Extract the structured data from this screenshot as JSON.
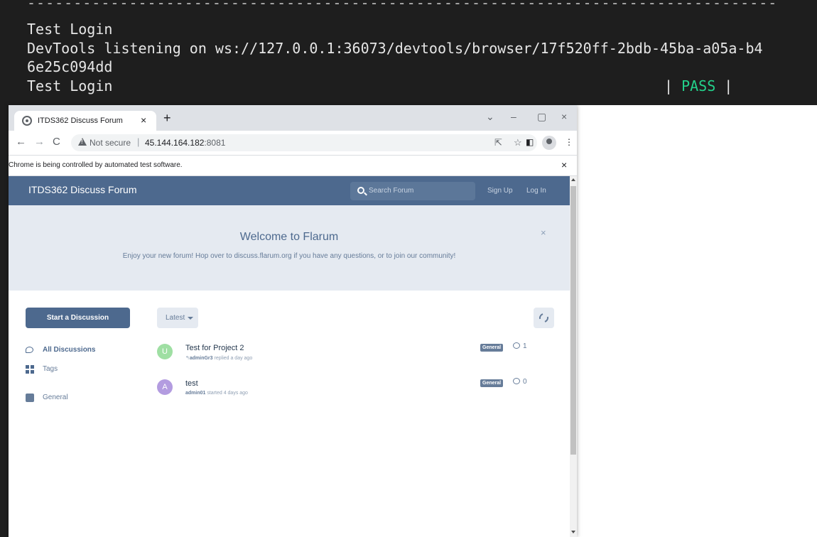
{
  "terminal": {
    "dashes": "---------------------------------------------------------------------------------",
    "line1": "Test Login",
    "line2": "DevTools listening on ws://127.0.0.1:36073/devtools/browser/17f520ff-2bdb-45ba-a05a-b4",
    "line3": "6e25c094dd",
    "line4": "Test Login",
    "pass_left": "| ",
    "pass_status": "PASS",
    "pass_right": " |",
    "status_color": "#23d18b"
  },
  "browser": {
    "tab_title": "ITDS362 Discuss Forum",
    "tab_close": "×",
    "new_tab": "+",
    "window_controls": {
      "dropdown": "⌄",
      "minimize": "–",
      "maximize": "▢",
      "close": "×"
    },
    "nav": {
      "back": "←",
      "forward": "→",
      "reload": "C"
    },
    "security_label": "Not secure",
    "url_separator": "|",
    "url_host": "45.144.164.182",
    "url_port": ":8081",
    "toolbar_icons": {
      "share": "⇱",
      "bookmark": "☆",
      "side_panel": "◧",
      "menu": "⋮"
    },
    "infobar_text": "Chrome is being controlled by automated test software.",
    "infobar_close": "×"
  },
  "forum": {
    "title": "ITDS362 Discuss Forum",
    "search_placeholder": "Search Forum",
    "signup": "Sign Up",
    "login": "Log In",
    "brand_color": "#4d698e",
    "hero": {
      "title": "Welcome to Flarum",
      "description": "Enjoy your new forum! Hop over to discuss.flarum.org if you have any questions, or to join our community!",
      "close": "×"
    },
    "start_discussion": "Start a Discussion",
    "sidebar": [
      {
        "label": "All Discussions",
        "icon": "chat-icon",
        "active": true
      },
      {
        "label": "Tags",
        "icon": "tags-icon",
        "active": false
      },
      {
        "label": "General",
        "icon": "tag-icon",
        "active": false
      }
    ],
    "sort_label": "Latest",
    "discussions": [
      {
        "avatar_letter": "U",
        "avatar_color": "#9fdfa3",
        "title": "Test for Project 2",
        "user": "adminGr3",
        "action": "replied a day ago",
        "reply_glyph": "↰",
        "tag": "General",
        "replies": "1"
      },
      {
        "avatar_letter": "A",
        "avatar_color": "#b39ce0",
        "title": "test",
        "user": "admin01",
        "action": "started 4 days ago",
        "reply_glyph": "",
        "tag": "General",
        "replies": "0"
      }
    ]
  }
}
